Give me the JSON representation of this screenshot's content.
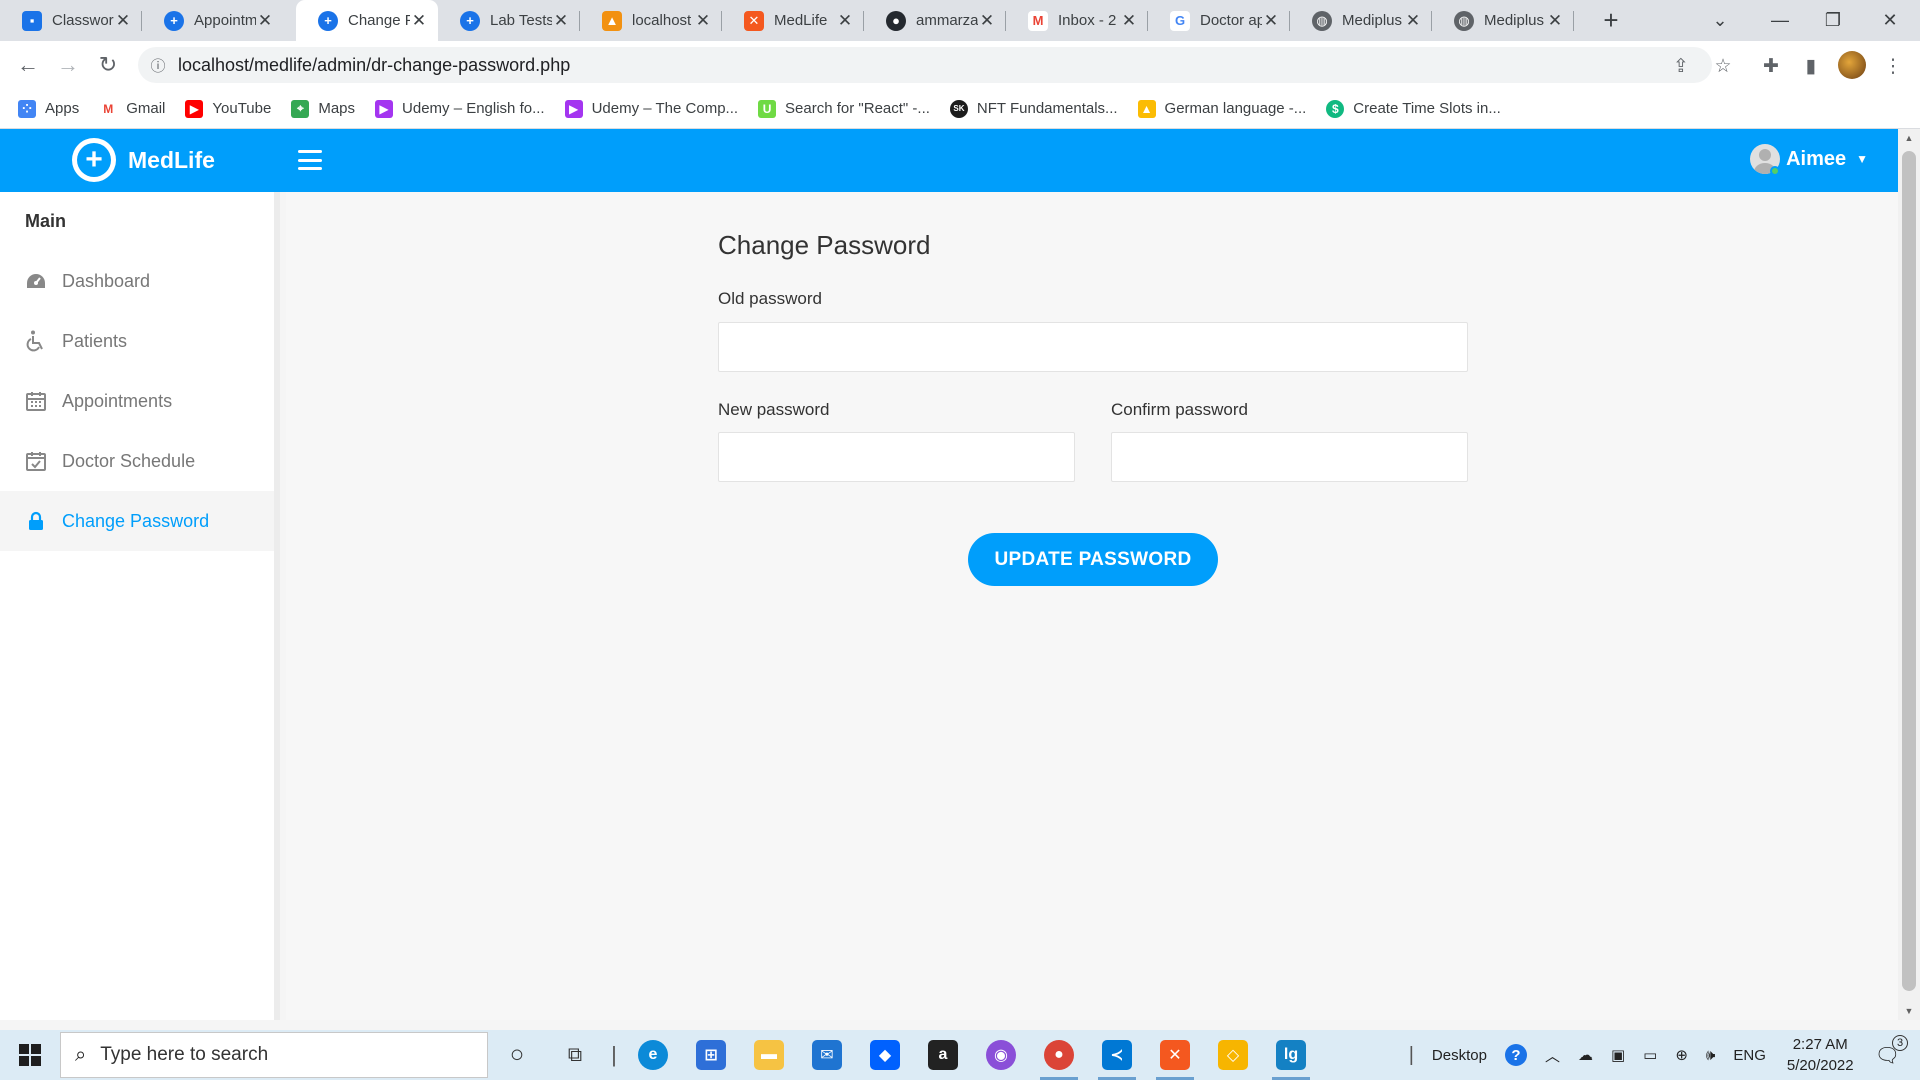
{
  "browser": {
    "tabs": [
      {
        "title": "Classwork",
        "favicon_color": "#1a73e8"
      },
      {
        "title": "Appointm",
        "favicon_color": "#1a73e8"
      },
      {
        "title": "Change P",
        "favicon_color": "#1a73e8",
        "active": true
      },
      {
        "title": "Lab Tests",
        "favicon_color": "#1a73e8"
      },
      {
        "title": "localhost",
        "favicon_color": "#f29111"
      },
      {
        "title": "MedLife",
        "favicon_color": "#f4581f"
      },
      {
        "title": "ammarza",
        "favicon_color": "#24292f"
      },
      {
        "title": "Inbox - 2",
        "favicon_color": "#ea4335"
      },
      {
        "title": "Doctor ap",
        "favicon_color": "#4285f4"
      },
      {
        "title": "Mediplus",
        "favicon_color": "#5f6368"
      },
      {
        "title": "Mediplus",
        "favicon_color": "#5f6368"
      }
    ],
    "url": "localhost/medlife/admin/dr-change-password.php",
    "bookmarks": [
      {
        "label": "Apps",
        "icon": "apps-grid-icon",
        "color": "#4285f4"
      },
      {
        "label": "Gmail",
        "icon": "gmail-icon",
        "color": "#ea4335"
      },
      {
        "label": "YouTube",
        "icon": "youtube-icon",
        "color": "#ff0000"
      },
      {
        "label": "Maps",
        "icon": "maps-icon",
        "color": "#34a853"
      },
      {
        "label": "Udemy – English fo...",
        "icon": "udemy-icon",
        "color": "#a435f0"
      },
      {
        "label": "Udemy – The Comp...",
        "icon": "udemy-icon",
        "color": "#a435f0"
      },
      {
        "label": "Search for \"React\" -...",
        "icon": "upwork-icon",
        "color": "#6fda44"
      },
      {
        "label": "NFT Fundamentals...",
        "icon": "sk-icon",
        "color": "#1c1c1c"
      },
      {
        "label": "German language -...",
        "icon": "drive-icon",
        "color": "#fbbc04"
      },
      {
        "label": "Create Time Slots in...",
        "icon": "dollar-icon",
        "color": "#10b981"
      }
    ]
  },
  "app": {
    "brand": "MedLife",
    "brand_color": "#009efb",
    "user": {
      "name": "Aimee",
      "status": "online"
    }
  },
  "sidebar": {
    "heading": "Main",
    "items": [
      {
        "label": "Dashboard",
        "icon": "dashboard-gauge-icon"
      },
      {
        "label": "Patients",
        "icon": "wheelchair-icon"
      },
      {
        "label": "Appointments",
        "icon": "calendar-icon"
      },
      {
        "label": "Doctor Schedule",
        "icon": "calendar-check-icon"
      },
      {
        "label": "Change Password",
        "icon": "lock-icon",
        "active": true
      }
    ]
  },
  "form": {
    "title": "Change Password",
    "old_label": "Old password",
    "old_value": "",
    "new_label": "New password",
    "new_value": "",
    "confirm_label": "Confirm password",
    "confirm_value": "",
    "submit": "UPDATE PASSWORD"
  },
  "taskbar": {
    "search_placeholder": "Type here to search",
    "desktop_label": "Desktop",
    "language": "ENG",
    "time": "2:27 AM",
    "date": "5/20/2022",
    "notification_count": "3"
  }
}
